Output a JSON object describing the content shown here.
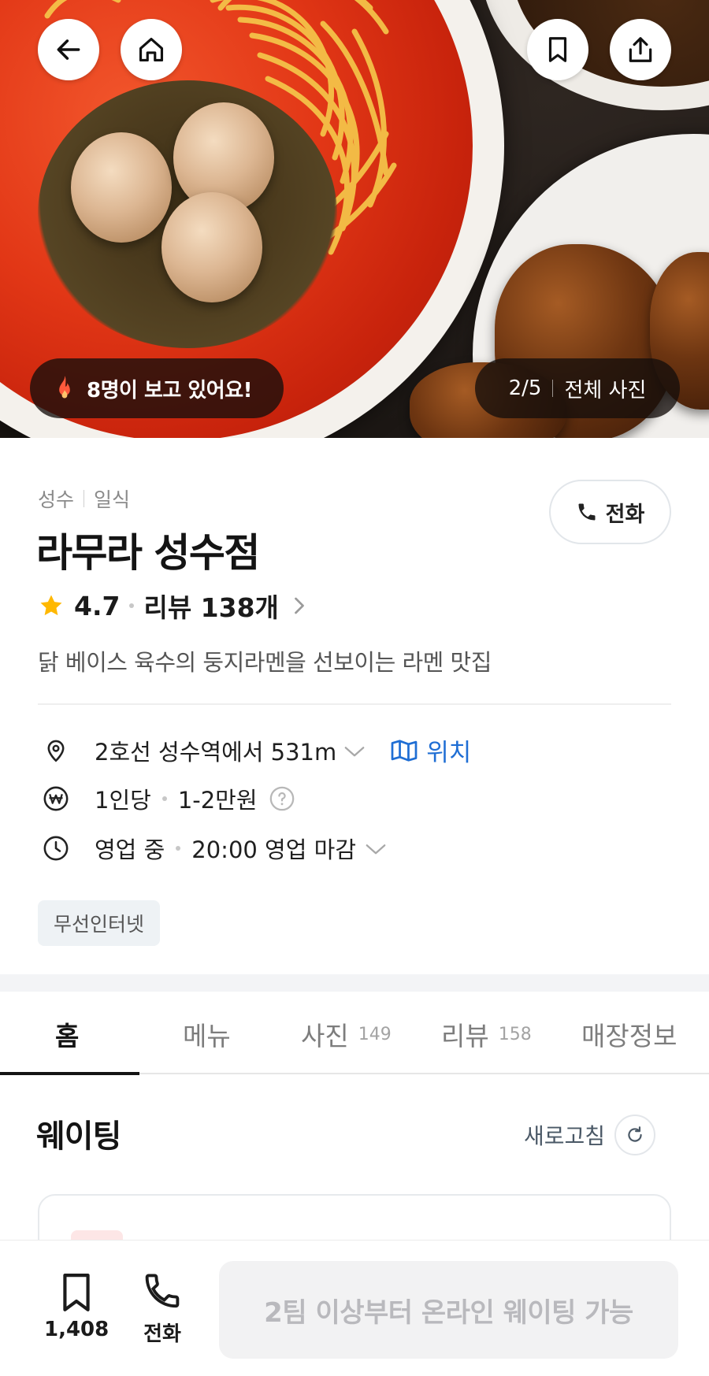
{
  "hero": {
    "watching_text": "8명이 보고 있어요!",
    "photo_counter": "2/5",
    "all_photos_label": "전체 사진",
    "icons": {
      "back": "arrow-left-icon",
      "home": "home-icon",
      "bookmark": "bookmark-icon",
      "share": "share-icon",
      "fire": "fire-icon"
    }
  },
  "info": {
    "area": "성수",
    "category": "일식",
    "call_label": "전화",
    "name": "라무라 성수점",
    "rating": "4.7",
    "review_label": "리뷰 138개",
    "description": "닭 베이스 육수의 둥지라멘을 선보이는 라멘 맛집",
    "distance": "2호선 성수역에서 531m",
    "map_label": "위치",
    "price_label": "1인당",
    "price_range": "1-2만원",
    "open_status": "영업 중",
    "closing": "20:00 영업 마감",
    "amenity": "무선인터넷",
    "colors": {
      "star": "#ffb800",
      "link": "#1f6ed4"
    }
  },
  "tabs": [
    {
      "label": "홈",
      "count": ""
    },
    {
      "label": "메뉴",
      "count": ""
    },
    {
      "label": "사진",
      "count": "149"
    },
    {
      "label": "리뷰",
      "count": "158"
    },
    {
      "label": "매장정보",
      "count": ""
    }
  ],
  "waiting": {
    "title": "웨이팅",
    "refresh_label": "새로고침"
  },
  "bottom_bar": {
    "save_count": "1,408",
    "call_label": "전화",
    "cta_label": "2팀 이상부터 온라인 웨이팅 가능"
  }
}
